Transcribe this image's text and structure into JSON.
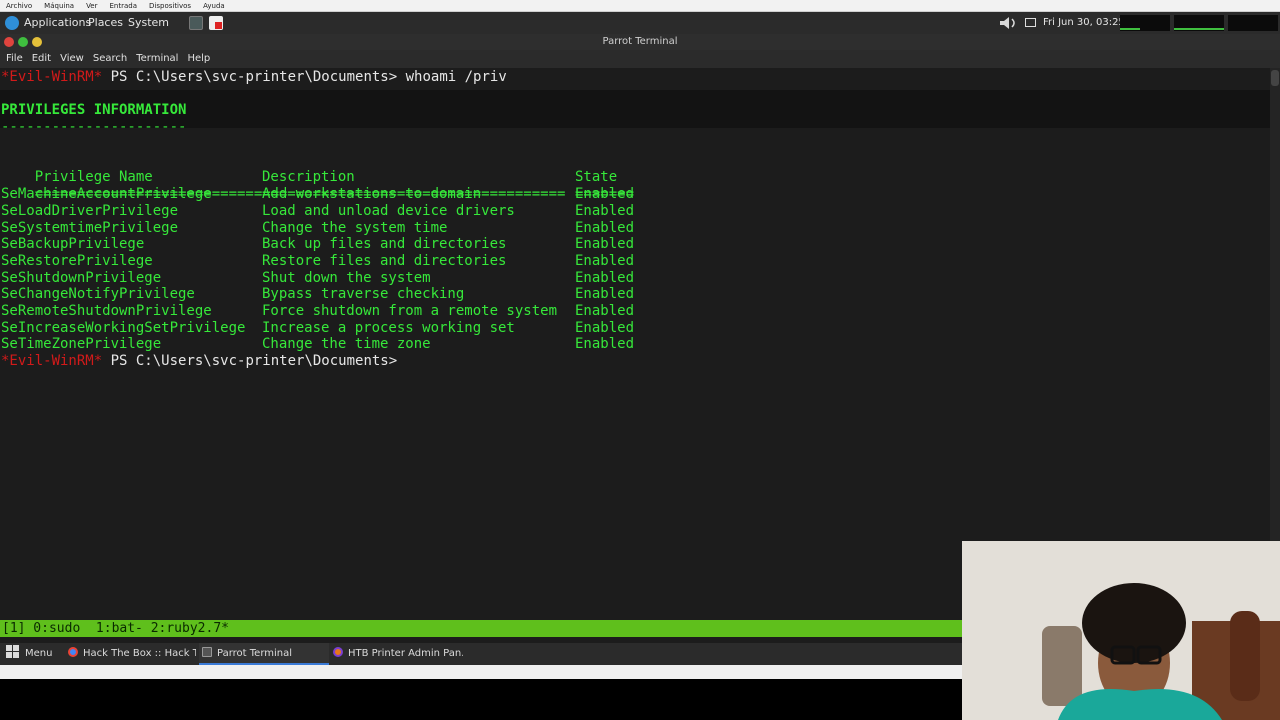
{
  "vm_menu": [
    "Archivo",
    "Máquina",
    "Ver",
    "Entrada",
    "Dispositivos",
    "Ayuda"
  ],
  "top_panel": {
    "applications": "Applications",
    "places": "Places",
    "system": "System",
    "clock": "Fri Jun 30, 03:25"
  },
  "window": {
    "title": "Parrot Terminal",
    "menu": [
      "File",
      "Edit",
      "View",
      "Search",
      "Terminal",
      "Help"
    ]
  },
  "terminal": {
    "prompt_tag": "*Evil-WinRM*",
    "prompt_path": " PS C:\\Users\\svc-printer\\Documents>",
    "command": " whoami /priv",
    "header": "PRIVILEGES INFORMATION",
    "header_rule": "----------------------",
    "columns": [
      "Privilege Name",
      "Description",
      "State"
    ],
    "column_rules": [
      "=============================",
      "====================================",
      "======="
    ],
    "rows": [
      [
        "SeMachineAccountPrivilege",
        "Add workstations to domain",
        "Enabled"
      ],
      [
        "SeLoadDriverPrivilege",
        "Load and unload device drivers",
        "Enabled"
      ],
      [
        "SeSystemtimePrivilege",
        "Change the system time",
        "Enabled"
      ],
      [
        "SeBackupPrivilege",
        "Back up files and directories",
        "Enabled"
      ],
      [
        "SeRestorePrivilege",
        "Restore files and directories",
        "Enabled"
      ],
      [
        "SeShutdownPrivilege",
        "Shut down the system",
        "Enabled"
      ],
      [
        "SeChangeNotifyPrivilege",
        "Bypass traverse checking",
        "Enabled"
      ],
      [
        "SeRemoteShutdownPrivilege",
        "Force shutdown from a remote system",
        "Enabled"
      ],
      [
        "SeIncreaseWorkingSetPrivilege",
        "Increase a process working set",
        "Enabled"
      ],
      [
        "SeTimeZonePrivilege",
        "Change the time zone",
        "Enabled"
      ]
    ]
  },
  "tmux_status": "[1] 0:sudo  1:bat- 2:ruby2.7*",
  "taskbar": {
    "menu": "Menu",
    "tasks": [
      "Hack The Box :: Hack Th...",
      "Parrot Terminal",
      "HTB Printer Admin Pan..."
    ]
  },
  "colors": {
    "terminal_green": "#36e83a",
    "prompt_red": "#d21a1a",
    "tmux_bar": "#5fbf1c",
    "panel": "#2b2b2b"
  }
}
